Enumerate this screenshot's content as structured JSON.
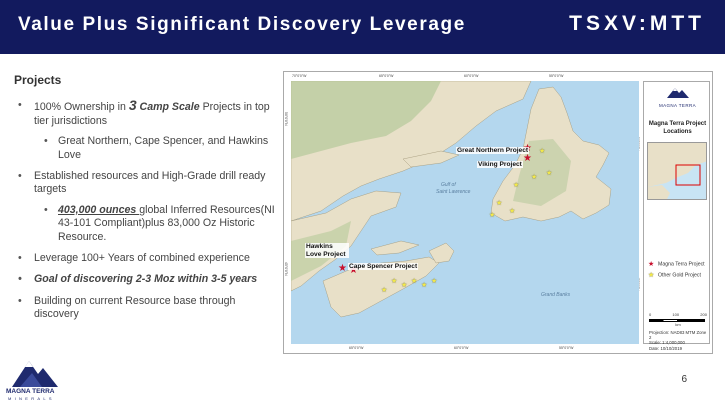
{
  "header": {
    "title": "Value Plus Significant Discovery Leverage",
    "ticker": "TSXV:MTT"
  },
  "content": {
    "section_title": "Projects",
    "b1_pre": "100% Ownership in ",
    "b1_num": "3",
    "b1_emph": " Camp Scale",
    "b1_post": " Projects in top tier jurisdictions",
    "b1_sub": "Great Northern, Cape Spencer, and Hawkins Love",
    "b2": "Established resources and High-Grade drill ready targets",
    "b2_sub_emph": "403,000 ounces ",
    "b2_sub_post": "global Inferred Resources(NI 43-101 Compliant)plus 83,000 Oz Historic Resource.",
    "b3": "Leverage 100+ Years of combined experience",
    "b4": "Goal of discovering 2-3 Moz within 3-5 years",
    "b5": "Building on current Resource base through discovery"
  },
  "map": {
    "labels": {
      "great_northern": "Great Northern Project",
      "viking": "Viking Project",
      "hawkins_love": "Hawkins Love Project",
      "cape_spencer": "Cape Spencer Project"
    },
    "coords": {
      "top": [
        "70°0'0\"W",
        "65°0'0\"W",
        "60°0'0\"W",
        "55°0'0\"W"
      ],
      "bottom": [
        "65°0'0\"W",
        "60°0'0\"W",
        "55°0'0\"W"
      ],
      "left": [
        "50°0'0\"N",
        "45°0'0\"N"
      ],
      "right": [
        "50°0'0\"N",
        "45°0'0\"N"
      ]
    },
    "legend": {
      "logo_text": "MAGNA TERRA",
      "title": "Magna Terra Project Locations",
      "item_project": "Magna Terra Project",
      "item_gold": "Other Gold Project",
      "scale_ticks": [
        "0",
        "100",
        "200"
      ],
      "scale_unit": "km",
      "meta_projection": "Projection: NAD83 MTM Zone 2",
      "meta_scale": "Scale:        1:4,000,000",
      "meta_date": "Date:          10/10/2019"
    },
    "colors": {
      "water": "#b4d7ee",
      "land": "#e8e0c8",
      "forest": "#b5c99a",
      "project_star": "#c8102e",
      "gold_star": "#f2e84a"
    }
  },
  "logo": {
    "name": "MAGNA TERRA",
    "sub": "MINERALS"
  },
  "page_number": "6"
}
